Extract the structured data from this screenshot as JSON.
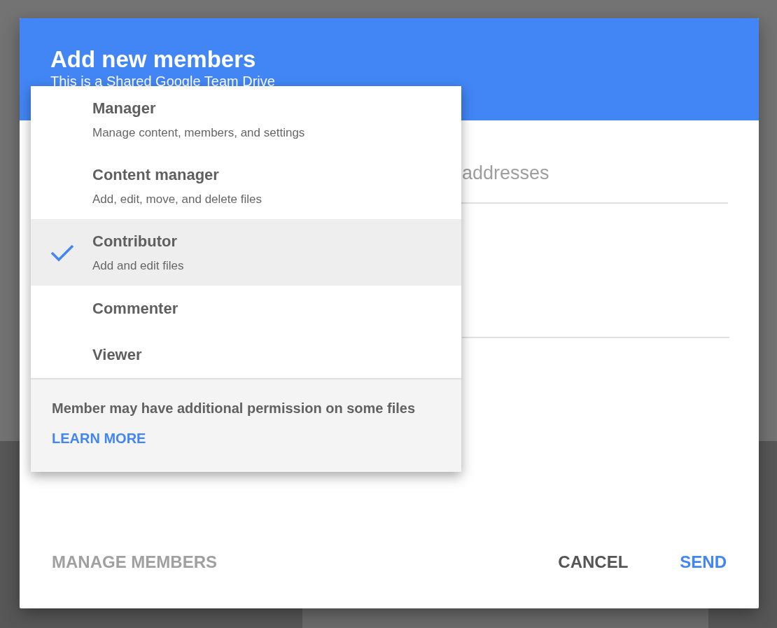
{
  "dialog": {
    "title": "Add new members",
    "subtitle": "This is a Shared Google Team Drive",
    "field": {
      "placeholder": "addresses"
    },
    "buttons": [
      {
        "label": "MANAGE MEMBERS",
        "kind": "muted"
      },
      {
        "label": "CANCEL",
        "kind": "plain"
      },
      {
        "label": "SEND",
        "kind": "primary"
      }
    ]
  },
  "role_menu": {
    "items": [
      {
        "label": "Manager",
        "description": "Manage content, members, and settings",
        "selected": false
      },
      {
        "label": "Content manager",
        "description": "Add, edit, move, and delete files",
        "selected": false
      },
      {
        "label": "Contributor",
        "description": "Add and edit files",
        "selected": true
      },
      {
        "label": "Commenter",
        "selected": false
      },
      {
        "label": "Viewer",
        "selected": false
      }
    ],
    "note": "Member may have additional permission on some files",
    "link": "LEARN MORE"
  }
}
